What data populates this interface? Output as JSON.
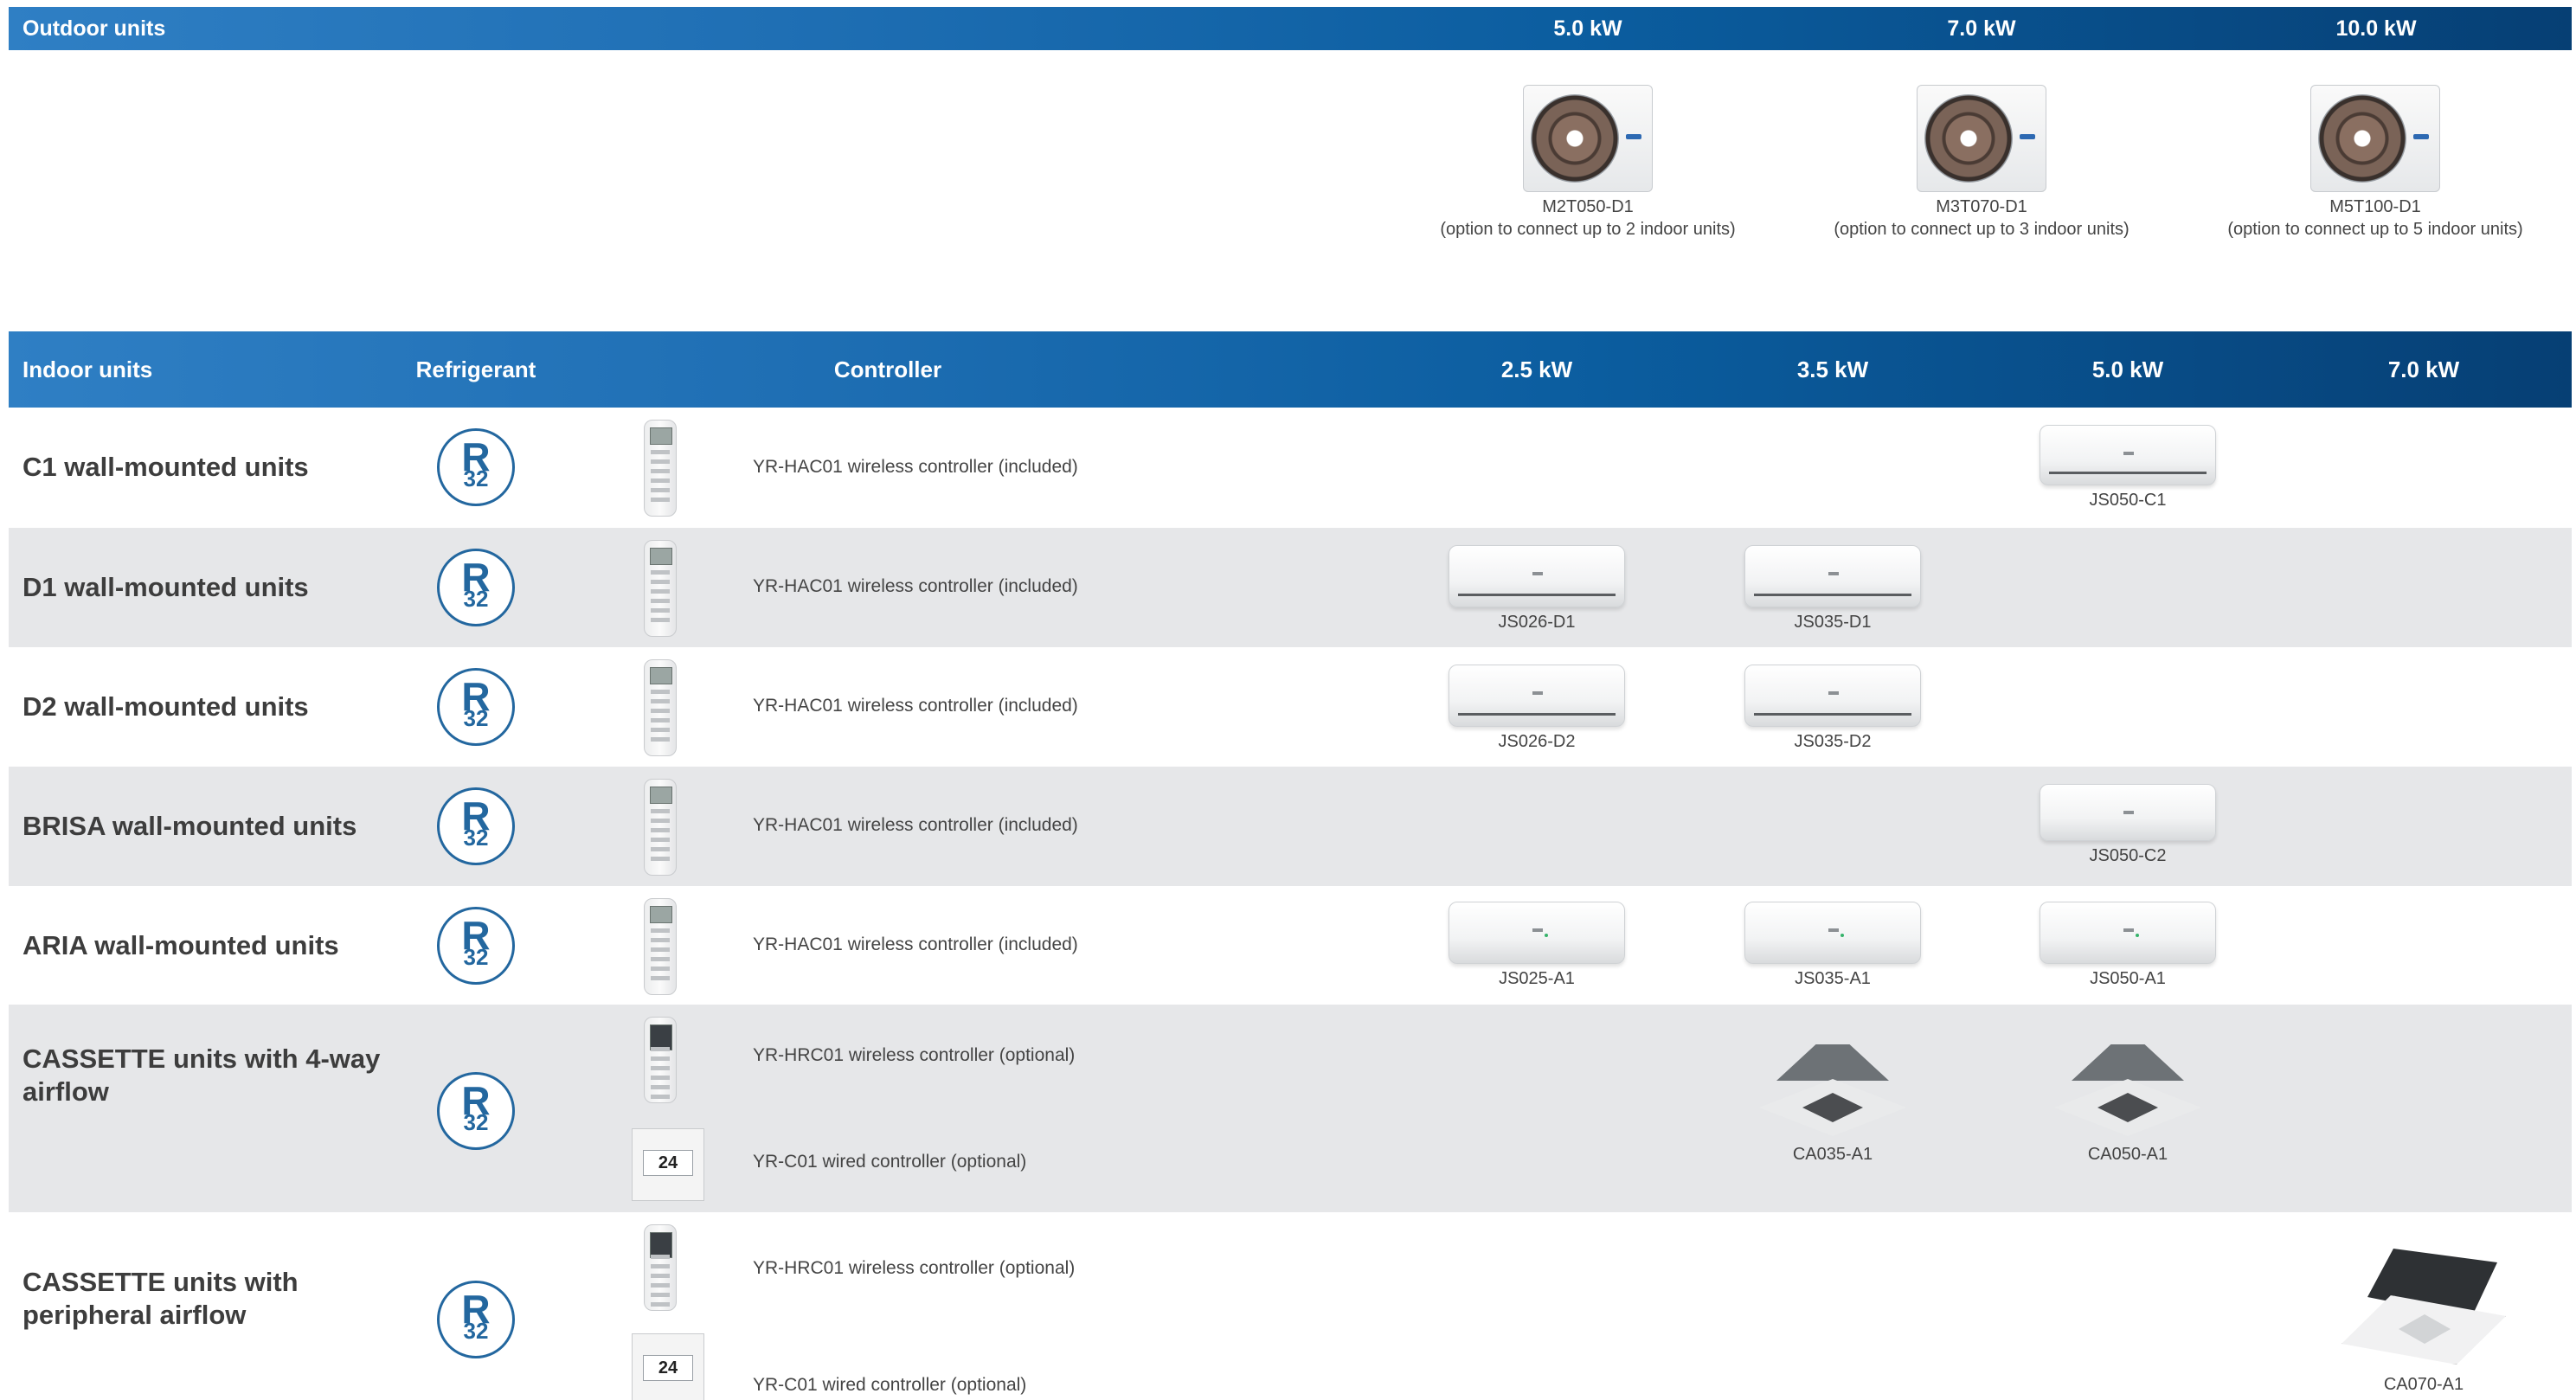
{
  "outdoor": {
    "header": "Outdoor units",
    "capacities": [
      "5.0 kW",
      "7.0 kW",
      "10.0 kW"
    ],
    "units": [
      {
        "model": "M2T050-D1",
        "option": "(option to connect up to 2 indoor units)"
      },
      {
        "model": "M3T070-D1",
        "option": "(option to connect up to 3 indoor units)"
      },
      {
        "model": "M5T100-D1",
        "option": "(option to connect up to 5 indoor units)"
      }
    ]
  },
  "indoor": {
    "header": "Indoor units",
    "refrigerant_header": "Refrigerant",
    "controller_header": "Controller",
    "capacities": [
      "2.5 kW",
      "3.5 kW",
      "5.0 kW",
      "7.0 kW"
    ],
    "refrigerant_badge": {
      "letter": "R",
      "number": "32"
    },
    "rows": [
      {
        "name": "C1 wall-mounted units",
        "controllers": [
          "YR-HAC01 wireless controller (included)"
        ],
        "units": {
          "c50": "JS050-C1"
        }
      },
      {
        "name": "D1 wall-mounted units",
        "controllers": [
          "YR-HAC01 wireless controller (included)"
        ],
        "units": {
          "c25": "JS026-D1",
          "c35": "JS035-D1"
        }
      },
      {
        "name": "D2 wall-mounted units",
        "controllers": [
          "YR-HAC01 wireless controller (included)"
        ],
        "units": {
          "c25": "JS026-D2",
          "c35": "JS035-D2"
        }
      },
      {
        "name": "BRISA wall-mounted units",
        "controllers": [
          "YR-HAC01 wireless controller (included)"
        ],
        "units": {
          "c50": "JS050-C2"
        }
      },
      {
        "name": "ARIA wall-mounted units",
        "controllers": [
          "YR-HAC01 wireless controller (included)"
        ],
        "units": {
          "c25": "JS025-A1",
          "c35": "JS035-A1",
          "c50": "JS050-A1"
        }
      },
      {
        "name": "CASSETTE units with 4-way airflow",
        "controllers": [
          "YR-HRC01 wireless controller (optional)",
          "YR-C01 wired controller (optional)"
        ],
        "units": {
          "c35": "CA035-A1",
          "c50": "CA050-A1"
        }
      },
      {
        "name": "CASSETTE units with peripheral airflow",
        "controllers": [
          "YR-HRC01 wireless controller (optional)",
          "YR-C01 wired controller (optional)"
        ],
        "units": {
          "c70": "CA070-A1"
        }
      }
    ],
    "wired_display": "24"
  },
  "colors": {
    "header_start": "#2f7fc4",
    "header_end": "#063f74",
    "badge": "#23679f",
    "alt_row": "#e6e7e9"
  }
}
